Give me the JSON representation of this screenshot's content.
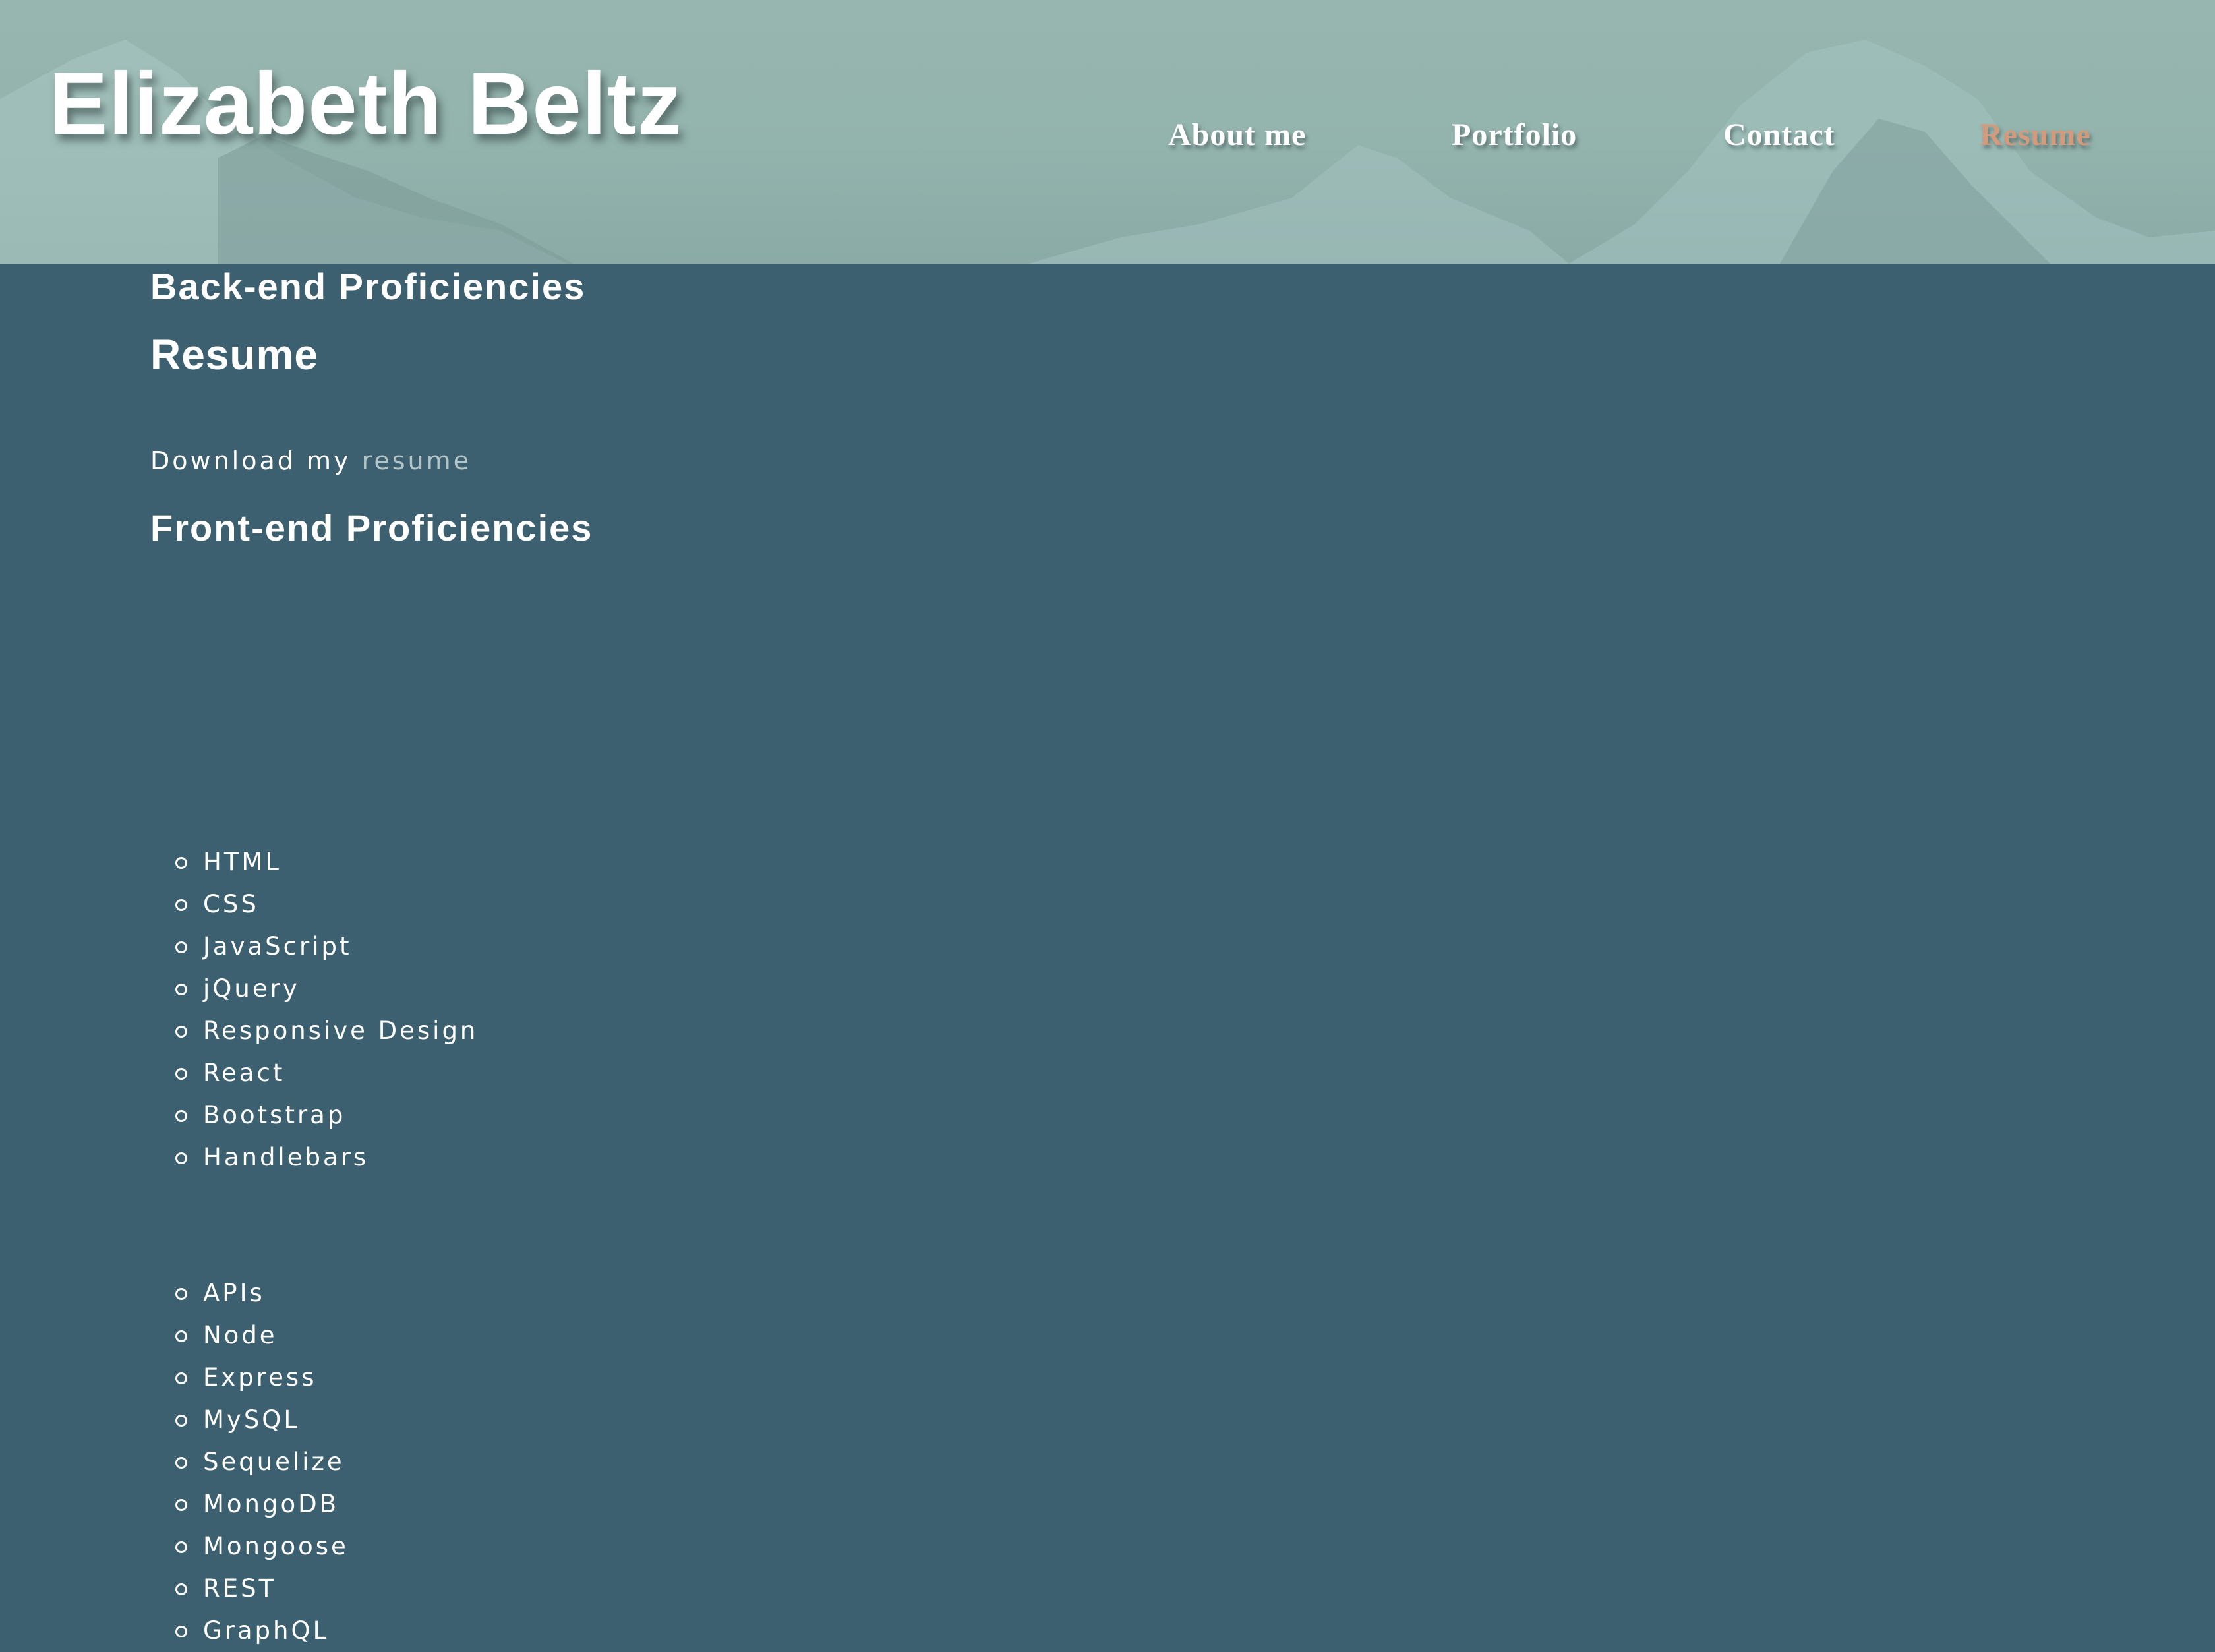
{
  "header": {
    "site_title": "Elizabeth Beltz",
    "nav": [
      {
        "label": "About me",
        "active": false
      },
      {
        "label": "Portfolio",
        "active": false
      },
      {
        "label": "Contact",
        "active": false
      },
      {
        "label": "Resume",
        "active": true
      }
    ]
  },
  "main": {
    "heading": "Resume",
    "download": {
      "prefix": "Download my",
      "link_label": "resume"
    },
    "frontend": {
      "heading": "Front-end Proficiencies",
      "items": [
        "HTML",
        "CSS",
        "JavaScript",
        "jQuery",
        "Responsive Design",
        "React",
        "Bootstrap",
        "Handlebars"
      ]
    },
    "backend": {
      "heading": "Back-end Proficiencies",
      "items": [
        "APIs",
        "Node",
        "Express",
        "MySQL",
        "Sequelize",
        "MongoDB",
        "Mongoose",
        "REST",
        "GraphQL"
      ]
    }
  },
  "colors": {
    "header_bg": "#95b4ae",
    "page_bg": "#3c6070",
    "active_nav": "#d39a7c",
    "link": "#b3c4c7",
    "text": "#ffffff"
  }
}
